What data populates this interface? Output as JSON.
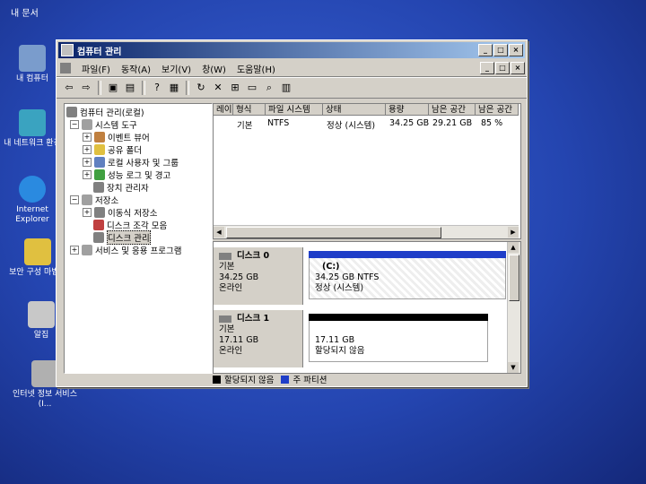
{
  "desktop": {
    "top_label": "내 문서",
    "icons": [
      {
        "label": "내 컴퓨터",
        "icon": "my-computer-icon",
        "color": "#7a9ccc"
      },
      {
        "label": "내 네트워크 환경",
        "icon": "network-icon",
        "color": "#3aa3c0"
      },
      {
        "label": "Internet Explorer",
        "icon": "internet-explorer-icon",
        "color": "#2a8ae0"
      },
      {
        "label": "보안 구성 마법사",
        "icon": "security-wizard-icon",
        "color": "#e0c040"
      },
      {
        "label": "알집",
        "icon": "alzip-icon",
        "color": "#c8c8c8"
      },
      {
        "label": "인터넷 정보 서비스(I...",
        "icon": "iis-icon",
        "color": "#b0b0b0"
      }
    ]
  },
  "window": {
    "title": "컴퓨터 관리",
    "controls": [
      "_",
      "□",
      "×"
    ],
    "menu": [
      "파일(F)",
      "동작(A)",
      "보기(V)",
      "창(W)",
      "도움말(H)"
    ],
    "toolbar": [
      "back-icon",
      "forward-icon",
      "up-icon",
      "show-tree-icon",
      "help-icon",
      "properties-icon",
      "refresh-icon",
      "delete-icon",
      "connect-icon",
      "open-icon",
      "search-icon",
      "export-icon"
    ]
  },
  "tree": {
    "items": [
      {
        "label": "컴퓨터 관리(로컬)",
        "level": 0,
        "expander": "",
        "icon_color": "#808080"
      },
      {
        "label": "시스템 도구",
        "level": 1,
        "expander": "−",
        "icon_color": "#a0a0a0"
      },
      {
        "label": "이벤트 뷰어",
        "level": 2,
        "expander": "+",
        "icon_color": "#c08040"
      },
      {
        "label": "공유 폴더",
        "level": 2,
        "expander": "+",
        "icon_color": "#e0c040"
      },
      {
        "label": "로컬 사용자 및 그룹",
        "level": 2,
        "expander": "+",
        "icon_color": "#6080c0"
      },
      {
        "label": "성능 로그 및 경고",
        "level": 2,
        "expander": "+",
        "icon_color": "#40a040"
      },
      {
        "label": "장치 관리자",
        "level": 2,
        "expander": "",
        "icon_color": "#808080"
      },
      {
        "label": "저장소",
        "level": 1,
        "expander": "−",
        "icon_color": "#a0a0a0"
      },
      {
        "label": "이동식 저장소",
        "level": 2,
        "expander": "+",
        "icon_color": "#808080"
      },
      {
        "label": "디스크 조각 모음",
        "level": 2,
        "expander": "",
        "icon_color": "#c04040"
      },
      {
        "label": "디스크 관리",
        "level": 2,
        "expander": "",
        "icon_color": "#808080",
        "selected": true
      },
      {
        "label": "서비스 및 응용 프로그램",
        "level": 1,
        "expander": "+",
        "icon_color": "#a0a0a0"
      }
    ]
  },
  "volume_list": {
    "columns": [
      "레이아웃",
      "형식",
      "파일 시스템",
      "상태",
      "용량",
      "남은 공간",
      "남은 공간"
    ],
    "rows": [
      {
        "layout": "",
        "type": "기본",
        "fs": "NTFS",
        "status": "정상 (시스템)",
        "capacity": "34.25 GB",
        "free": "29.21 GB",
        "free_pct": "85 %"
      }
    ]
  },
  "disks": [
    {
      "name": "디스크 0",
      "type": "기본",
      "size": "34.25 GB",
      "state": "온라인",
      "bar_color": "#1f3ec8",
      "part_title": "(C:)",
      "part_line1": "34.25 GB NTFS",
      "part_line2": "정상 (시스템)"
    },
    {
      "name": "디스크 1",
      "type": "기본",
      "size": "17.11 GB",
      "state": "온라인",
      "bar_color": "#000000",
      "part_title": "",
      "part_line1": "17.11 GB",
      "part_line2": "할당되지 않음"
    }
  ],
  "legend": [
    {
      "label": "할당되지 않음",
      "color": "#000000"
    },
    {
      "label": "주 파티션",
      "color": "#1f3ec8"
    }
  ]
}
